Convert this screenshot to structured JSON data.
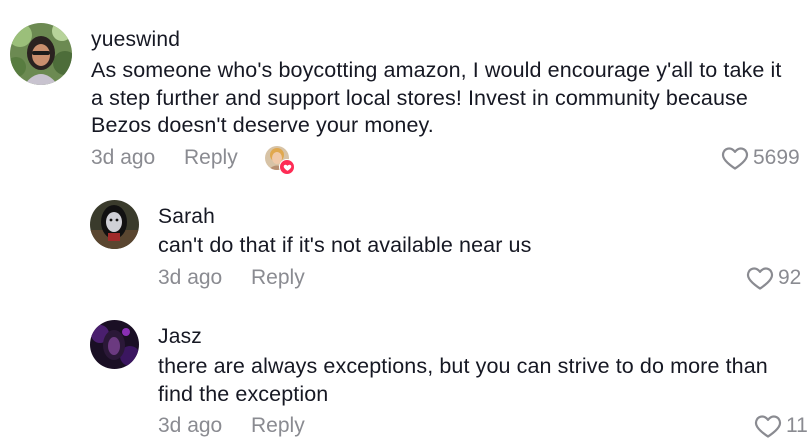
{
  "comments": [
    {
      "username": "yueswind",
      "text": "As someone who's boycotting amazon, I would encourage y'all to take it a step further and support local stores! Invest in community because Bezos doesn't deserve your money.",
      "time": "3d ago",
      "reply_label": "Reply",
      "likes": "5699",
      "creator_liked": true
    },
    {
      "username": "Sarah",
      "text": "can't do that if it's not available near us",
      "time": "3d ago",
      "reply_label": "Reply",
      "likes": "92"
    },
    {
      "username": "Jasz",
      "text": "there are always exceptions, but you can strive to do more than find the exception",
      "time": "3d ago",
      "reply_label": "Reply",
      "likes": "11"
    }
  ],
  "icons": {
    "like": "heart-outline-icon",
    "creator_liked": "creator-liked-heart-badge"
  },
  "colors": {
    "text": "#161823",
    "muted": "#8a8b91",
    "badge": "#fe2c55"
  }
}
